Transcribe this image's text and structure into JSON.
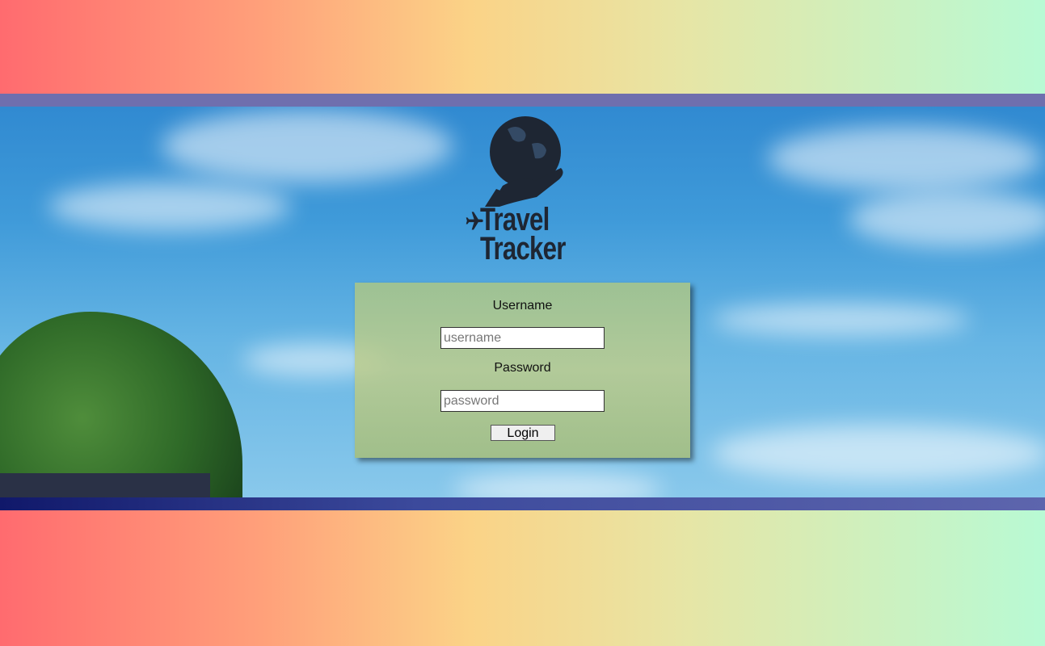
{
  "logo": {
    "line1": "Travel",
    "line2": "Tracker"
  },
  "login": {
    "username_label": "Username",
    "username_value": "",
    "username_placeholder": "username",
    "password_label": "Password",
    "password_value": "",
    "password_placeholder": "password",
    "submit_label": "Login"
  },
  "colors": {
    "logo": "#1e2633",
    "stripe": "#6f6fae",
    "panel": "#b0c68a"
  },
  "icons": [
    "globe-in-hand-icon",
    "airplane-icon"
  ]
}
